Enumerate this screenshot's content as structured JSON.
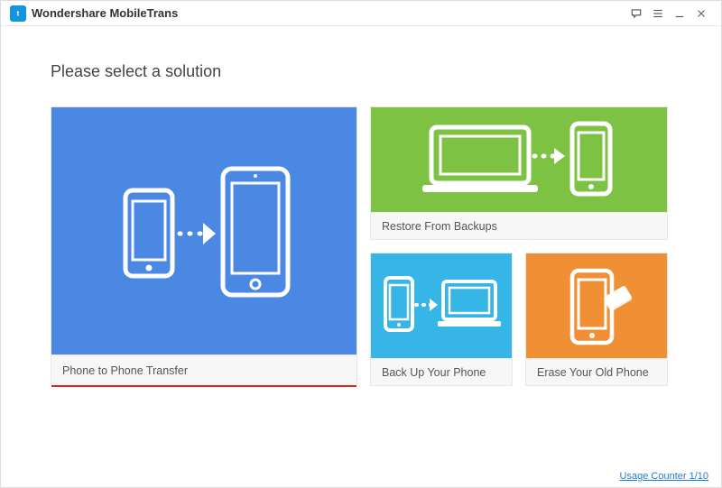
{
  "titlebar": {
    "app_name": "Wondershare MobileTrans"
  },
  "heading": "Please select a solution",
  "cards": {
    "phone_to_phone": {
      "label": "Phone to Phone Transfer",
      "icon": "phone-to-phone-icon"
    },
    "restore": {
      "label": "Restore From Backups",
      "icon": "laptop-to-phone-icon"
    },
    "backup": {
      "label": "Back Up Your Phone",
      "icon": "phone-to-laptop-icon"
    },
    "erase": {
      "label": "Erase Your Old Phone",
      "icon": "phone-erase-icon"
    }
  },
  "footer": {
    "usage_counter": "Usage Counter 1/10"
  },
  "colors": {
    "blue": "#4a88e3",
    "green": "#7dc243",
    "cyan": "#35b6e6",
    "orange": "#f18f34",
    "red_underline": "#e2231a",
    "link": "#1f7dd4"
  }
}
